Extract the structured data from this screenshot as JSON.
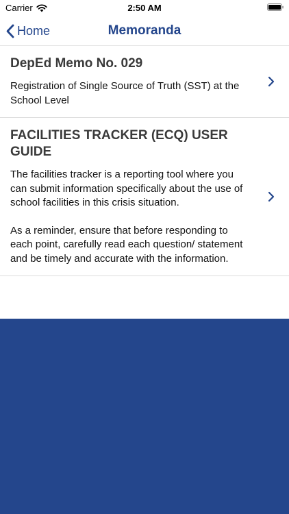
{
  "status_bar": {
    "carrier": "Carrier",
    "time": "2:50 AM"
  },
  "nav": {
    "back_label": "Home",
    "title": "Memoranda"
  },
  "memos": [
    {
      "title": "DepEd Memo No. 029",
      "paragraphs": [
        "Registration of Single Source of Truth (SST) at the School Level"
      ]
    },
    {
      "title": "FACILITIES TRACKER (ECQ) USER GUIDE",
      "paragraphs": [
        "The facilities tracker is a reporting tool where you can submit information specifically about the use of school facilities in this crisis situation.",
        "As a reminder, ensure that before responding to each point, carefully read each question/ statement and be timely and accurate with the information."
      ]
    }
  ],
  "colors": {
    "accent": "#24468c",
    "footer": "#24468c"
  }
}
